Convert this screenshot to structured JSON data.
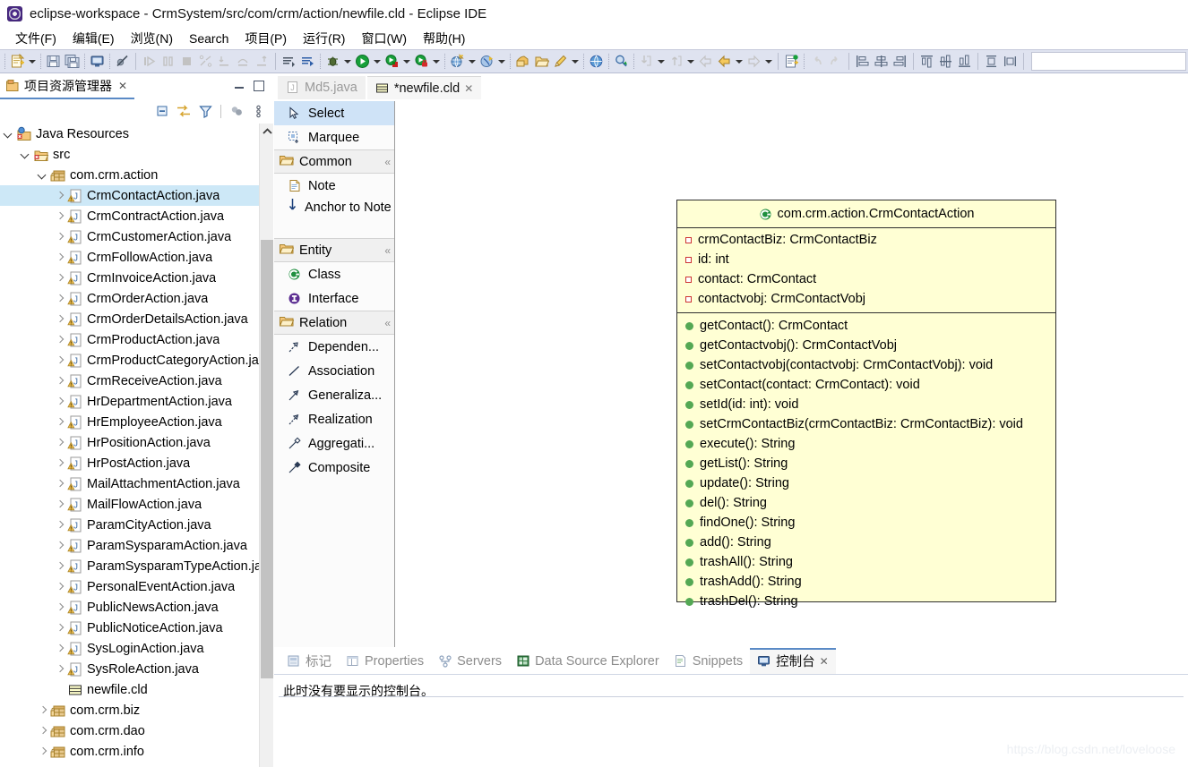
{
  "window": {
    "title": "eclipse-workspace - CrmSystem/src/com/crm/action/newfile.cld - Eclipse IDE",
    "app_icon": "eclipse-icon"
  },
  "menubar": {
    "items": [
      {
        "label": "文件(F)",
        "name": "menu-file"
      },
      {
        "label": "编辑(E)",
        "name": "menu-edit"
      },
      {
        "label": "浏览(N)",
        "name": "menu-navigate"
      },
      {
        "label": "Search",
        "name": "menu-search"
      },
      {
        "label": "项目(P)",
        "name": "menu-project"
      },
      {
        "label": "运行(R)",
        "name": "menu-run"
      },
      {
        "label": "窗口(W)",
        "name": "menu-window"
      },
      {
        "label": "帮助(H)",
        "name": "menu-help"
      }
    ]
  },
  "explorer": {
    "tab_label": "项目资源管理器",
    "tab_icon": "package-explorer-icon",
    "close_glyph": "✕",
    "toolbar": [
      {
        "name": "collapse-all-icon"
      },
      {
        "name": "link-with-editor-icon"
      },
      {
        "name": "filter-icon"
      },
      {
        "name": "working-sets-icon"
      },
      {
        "name": "view-menu-icon"
      }
    ],
    "tree": [
      {
        "label": "Java Resources",
        "indent": 1,
        "twisty": "open",
        "icon": "java-resources-icon",
        "selected": false
      },
      {
        "label": "src",
        "indent": 2,
        "twisty": "open",
        "icon": "source-folder-icon",
        "selected": false
      },
      {
        "label": "com.crm.action",
        "indent": 3,
        "twisty": "open",
        "icon": "package-icon",
        "selected": false
      },
      {
        "label": "CrmContactAction.java",
        "indent": 4,
        "twisty": "closed",
        "icon": "java-file-warning-icon",
        "selected": true
      },
      {
        "label": "CrmContractAction.java",
        "indent": 4,
        "twisty": "closed",
        "icon": "java-file-warning-icon",
        "selected": false
      },
      {
        "label": "CrmCustomerAction.java",
        "indent": 4,
        "twisty": "closed",
        "icon": "java-file-warning-icon",
        "selected": false
      },
      {
        "label": "CrmFollowAction.java",
        "indent": 4,
        "twisty": "closed",
        "icon": "java-file-warning-icon",
        "selected": false
      },
      {
        "label": "CrmInvoiceAction.java",
        "indent": 4,
        "twisty": "closed",
        "icon": "java-file-warning-icon",
        "selected": false
      },
      {
        "label": "CrmOrderAction.java",
        "indent": 4,
        "twisty": "closed",
        "icon": "java-file-warning-icon",
        "selected": false
      },
      {
        "label": "CrmOrderDetailsAction.java",
        "indent": 4,
        "twisty": "closed",
        "icon": "java-file-warning-icon",
        "selected": false
      },
      {
        "label": "CrmProductAction.java",
        "indent": 4,
        "twisty": "closed",
        "icon": "java-file-warning-icon",
        "selected": false
      },
      {
        "label": "CrmProductCategoryAction.java",
        "indent": 4,
        "twisty": "closed",
        "icon": "java-file-warning-icon",
        "selected": false
      },
      {
        "label": "CrmReceiveAction.java",
        "indent": 4,
        "twisty": "closed",
        "icon": "java-file-warning-icon",
        "selected": false
      },
      {
        "label": "HrDepartmentAction.java",
        "indent": 4,
        "twisty": "closed",
        "icon": "java-file-warning-icon",
        "selected": false
      },
      {
        "label": "HrEmployeeAction.java",
        "indent": 4,
        "twisty": "closed",
        "icon": "java-file-warning-icon",
        "selected": false
      },
      {
        "label": "HrPositionAction.java",
        "indent": 4,
        "twisty": "closed",
        "icon": "java-file-warning-icon",
        "selected": false
      },
      {
        "label": "HrPostAction.java",
        "indent": 4,
        "twisty": "closed",
        "icon": "java-file-warning-icon",
        "selected": false
      },
      {
        "label": "MailAttachmentAction.java",
        "indent": 4,
        "twisty": "closed",
        "icon": "java-file-warning-icon",
        "selected": false
      },
      {
        "label": "MailFlowAction.java",
        "indent": 4,
        "twisty": "closed",
        "icon": "java-file-warning-icon",
        "selected": false
      },
      {
        "label": "ParamCityAction.java",
        "indent": 4,
        "twisty": "closed",
        "icon": "java-file-warning-icon",
        "selected": false
      },
      {
        "label": "ParamSysparamAction.java",
        "indent": 4,
        "twisty": "closed",
        "icon": "java-file-warning-icon",
        "selected": false
      },
      {
        "label": "ParamSysparamTypeAction.java",
        "indent": 4,
        "twisty": "closed",
        "icon": "java-file-warning-icon",
        "selected": false
      },
      {
        "label": "PersonalEventAction.java",
        "indent": 4,
        "twisty": "closed",
        "icon": "java-file-warning-icon",
        "selected": false
      },
      {
        "label": "PublicNewsAction.java",
        "indent": 4,
        "twisty": "closed",
        "icon": "java-file-warning-icon",
        "selected": false
      },
      {
        "label": "PublicNoticeAction.java",
        "indent": 4,
        "twisty": "closed",
        "icon": "java-file-warning-icon",
        "selected": false
      },
      {
        "label": "SysLoginAction.java",
        "indent": 4,
        "twisty": "closed",
        "icon": "java-file-warning-icon",
        "selected": false
      },
      {
        "label": "SysRoleAction.java",
        "indent": 4,
        "twisty": "closed",
        "icon": "java-file-warning-icon",
        "selected": false
      },
      {
        "label": "newfile.cld",
        "indent": 4,
        "twisty": "none",
        "icon": "cld-file-icon",
        "selected": false
      },
      {
        "label": "com.crm.biz",
        "indent": 3,
        "twisty": "closed",
        "icon": "package-icon",
        "selected": false
      },
      {
        "label": "com.crm.dao",
        "indent": 3,
        "twisty": "closed",
        "icon": "package-icon",
        "selected": false
      },
      {
        "label": "com.crm.info",
        "indent": 3,
        "twisty": "closed",
        "icon": "package-icon",
        "selected": false
      }
    ]
  },
  "editor": {
    "tabs": [
      {
        "label": "Md5.java",
        "icon": "java-file-icon",
        "active": false,
        "closable": false
      },
      {
        "label": "*newfile.cld",
        "icon": "cld-file-icon",
        "active": true,
        "closable": true,
        "close_glyph": "✕"
      }
    ]
  },
  "palette": {
    "tools": [
      {
        "label": "Select",
        "icon": "cursor-arrow-icon",
        "selected": true
      },
      {
        "label": "Marquee",
        "icon": "marquee-icon",
        "selected": false
      }
    ],
    "groups": [
      {
        "name": "Common",
        "icon": "folder-icon",
        "collapse_glyph": "«",
        "items": [
          {
            "label": "Note",
            "icon": "note-icon"
          },
          {
            "label": "Anchor to Note",
            "icon": "anchor-arrow-icon",
            "wrap": true
          }
        ]
      },
      {
        "name": "Entity",
        "icon": "folder-icon",
        "collapse_glyph": "«",
        "items": [
          {
            "label": "Class",
            "icon": "class-icon"
          },
          {
            "label": "Interface",
            "icon": "interface-icon"
          }
        ]
      },
      {
        "name": "Relation",
        "icon": "folder-icon",
        "collapse_glyph": "«",
        "items": [
          {
            "label": "Dependen...",
            "icon": "dependency-icon"
          },
          {
            "label": "Association",
            "icon": "association-icon"
          },
          {
            "label": "Generaliza...",
            "icon": "generalization-icon"
          },
          {
            "label": "Realization",
            "icon": "realization-icon"
          },
          {
            "label": "Aggregati...",
            "icon": "aggregation-icon"
          },
          {
            "label": "Composite",
            "icon": "composition-icon"
          }
        ]
      }
    ]
  },
  "uml": {
    "class_icon": "class-icon",
    "title": "com.crm.action.CrmContactAction",
    "attributes": [
      "crmContactBiz: CrmContactBiz",
      "id: int",
      "contact: CrmContact",
      "contactvobj: CrmContactVobj"
    ],
    "methods": [
      "getContact(): CrmContact",
      "getContactvobj(): CrmContactVobj",
      "setContactvobj(contactvobj: CrmContactVobj): void",
      "setContact(contact: CrmContact): void",
      "setId(id: int): void",
      "setCrmContactBiz(crmContactBiz: CrmContactBiz): void",
      "execute(): String",
      "getList(): String",
      "update(): String",
      "del(): String",
      "findOne(): String",
      "add(): String",
      "trashAll(): String",
      "trashAdd(): String",
      "trashDel(): String"
    ],
    "fill_color": "#ffffd4",
    "border_color": "#2f2f2f",
    "attr_marker_color": "#cc3333",
    "method_marker_color": "#54a854"
  },
  "bottom": {
    "tabs": [
      {
        "label": "标记",
        "icon": "markers-icon",
        "active": false
      },
      {
        "label": "Properties",
        "icon": "properties-icon",
        "active": false
      },
      {
        "label": "Servers",
        "icon": "servers-icon",
        "active": false
      },
      {
        "label": "Data Source Explorer",
        "icon": "data-source-icon",
        "active": false
      },
      {
        "label": "Snippets",
        "icon": "snippets-icon",
        "active": false
      },
      {
        "label": "控制台",
        "icon": "console-icon",
        "active": true,
        "close_glyph": "✕"
      }
    ],
    "message": "此时没有要显示的控制台。"
  },
  "watermark": "https://blog.csdn.net/loveloose"
}
